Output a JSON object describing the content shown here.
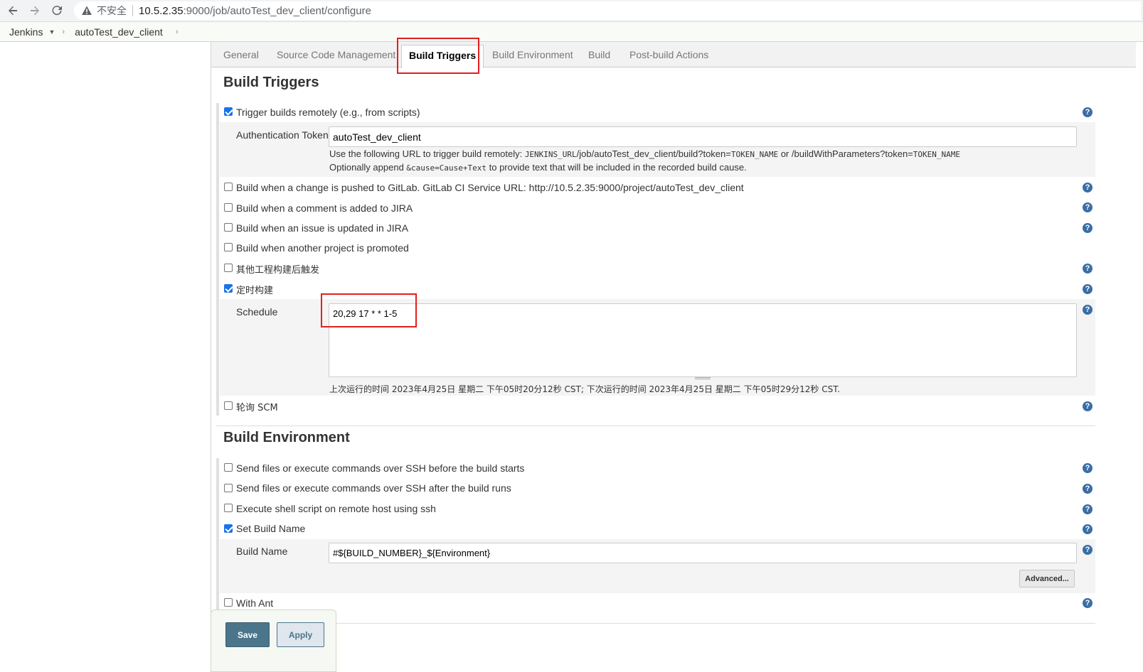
{
  "browser": {
    "insecure_label": "不安全",
    "url_host": "10.5.2.35",
    "url_rest": ":9000/job/autoTest_dev_client/configure"
  },
  "breadcrumb": {
    "root": "Jenkins",
    "job": "autoTest_dev_client"
  },
  "tabs": [
    {
      "label": "General"
    },
    {
      "label": "Source Code Management"
    },
    {
      "label": "Build Triggers"
    },
    {
      "label": "Build Environment"
    },
    {
      "label": "Build"
    },
    {
      "label": "Post-build Actions"
    }
  ],
  "build_triggers": {
    "title": "Build Triggers",
    "remote": {
      "label": "Trigger builds remotely (e.g., from scripts)",
      "checked": true,
      "token_label": "Authentication Token",
      "token_value": "autoTest_dev_client",
      "hint1_a": "Use the following URL to trigger build remotely: ",
      "hint1_b": "JENKINS_URL",
      "hint1_c": "/job/autoTest_dev_client/build?token=",
      "hint1_d": "TOKEN_NAME",
      "hint1_e": " or /buildWithParameters?token=",
      "hint1_f": "TOKEN_NAME",
      "hint2_a": "Optionally append ",
      "hint2_b": "&cause=Cause+Text",
      "hint2_c": " to provide text that will be included in the recorded build cause."
    },
    "gitlab": "Build when a change is pushed to GitLab. GitLab CI Service URL: http://10.5.2.35:9000/project/autoTest_dev_client",
    "jira_comment": "Build when a comment is added to JIRA",
    "jira_issue": "Build when an issue is updated in JIRA",
    "promoted": "Build when another project is promoted",
    "other_project": "其他工程构建后触发",
    "timer": {
      "label": "定时构建",
      "checked": true,
      "schedule_label": "Schedule",
      "schedule_value": "20,29 17 * * 1-5",
      "run_info": "上次运行的时间 2023年4月25日 星期二 下午05时20分12秒 CST; 下次运行的时间 2023年4月25日 星期二 下午05时29分12秒 CST."
    },
    "poll_scm": "轮询 SCM"
  },
  "build_env": {
    "title": "Build Environment",
    "ssh_before": "Send files or execute commands over SSH before the build starts",
    "ssh_after": "Send files or execute commands over SSH after the build runs",
    "remote_shell": "Execute shell script on remote host using ssh",
    "set_build_name": {
      "label": "Set Build Name",
      "checked": true,
      "name_label": "Build Name",
      "name_value": "#${BUILD_NUMBER}_${Environment}",
      "advanced": "Advanced..."
    },
    "with_ant": "With Ant"
  },
  "actions": {
    "save": "Save",
    "apply": "Apply"
  },
  "colors": {
    "checked": "#1a73e8",
    "help": "#3a6ea5",
    "highlight": "#e02020",
    "save_bg": "#4b758b"
  }
}
